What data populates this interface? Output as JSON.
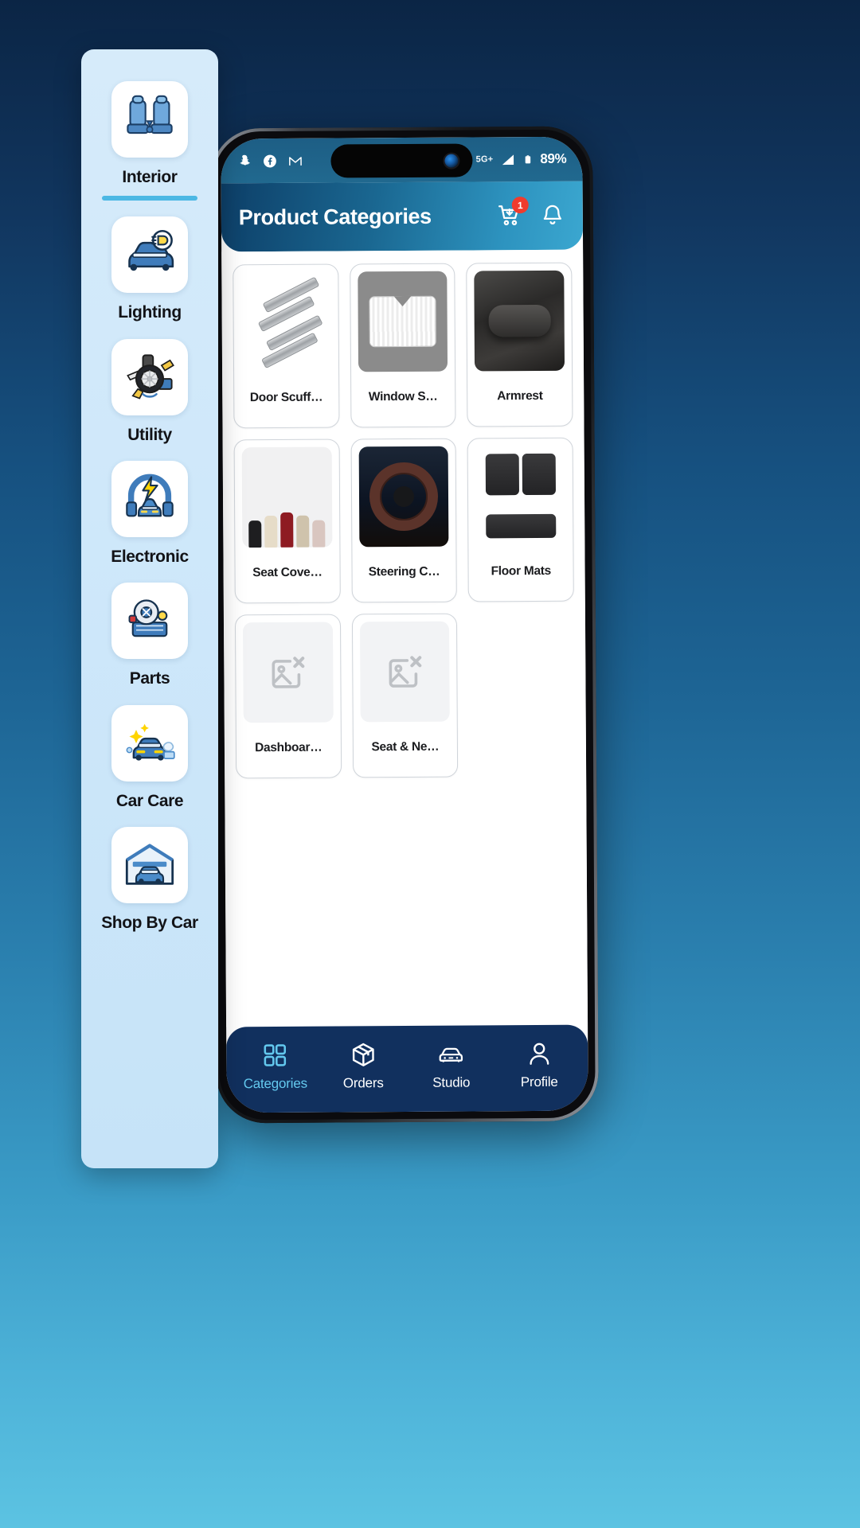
{
  "statusbar": {
    "left_icons": [
      "snapchat-icon",
      "facebook-icon",
      "gmail-icon"
    ],
    "right_icons": [
      "alarm-icon",
      "missed-call-icon",
      "wifi-icon",
      "signal-icon"
    ],
    "network": "5G+",
    "battery": "89%"
  },
  "header": {
    "title": "Product Categories",
    "cart_badge": "1",
    "cart_icon": "shopping-cart-icon",
    "bell_icon": "notification-bell-icon"
  },
  "sidebar": {
    "items": [
      {
        "label": "Interior",
        "icon": "car-seats-icon",
        "active": true
      },
      {
        "label": "Lighting",
        "icon": "car-headlight-icon",
        "active": false
      },
      {
        "label": "Utility",
        "icon": "car-tools-icon",
        "active": false
      },
      {
        "label": "Electronic",
        "icon": "car-electric-icon",
        "active": false
      },
      {
        "label": "Parts",
        "icon": "car-engine-icon",
        "active": false
      },
      {
        "label": "Car Care",
        "icon": "car-wash-icon",
        "active": false
      },
      {
        "label": "Shop By Car",
        "icon": "car-garage-icon",
        "active": false
      }
    ]
  },
  "products": [
    {
      "name": "Door Scuff…",
      "art": "scuff",
      "has_image": true
    },
    {
      "name": "Window S…",
      "art": "shade",
      "has_image": true
    },
    {
      "name": "Armrest",
      "art": "armrest",
      "has_image": true
    },
    {
      "name": "Seat Cove…",
      "art": "seatcover",
      "has_image": true
    },
    {
      "name": "Steering C…",
      "art": "steer",
      "has_image": true
    },
    {
      "name": "Floor Mats",
      "art": "mats",
      "has_image": true
    },
    {
      "name": "Dashboar…",
      "art": "placeholder",
      "has_image": false
    },
    {
      "name": "Seat & Ne…",
      "art": "placeholder",
      "has_image": false
    }
  ],
  "bottom_nav": [
    {
      "label": "Categories",
      "icon": "grid-icon",
      "active": true
    },
    {
      "label": "Orders",
      "icon": "box-icon",
      "active": false
    },
    {
      "label": "Studio",
      "icon": "car-icon",
      "active": false
    },
    {
      "label": "Profile",
      "icon": "person-icon",
      "active": false
    }
  ],
  "colors": {
    "accent": "#4cb8e4",
    "nav_bg": "#11305e",
    "badge": "#ef3b2d",
    "active_nav": "#63c8ee"
  }
}
